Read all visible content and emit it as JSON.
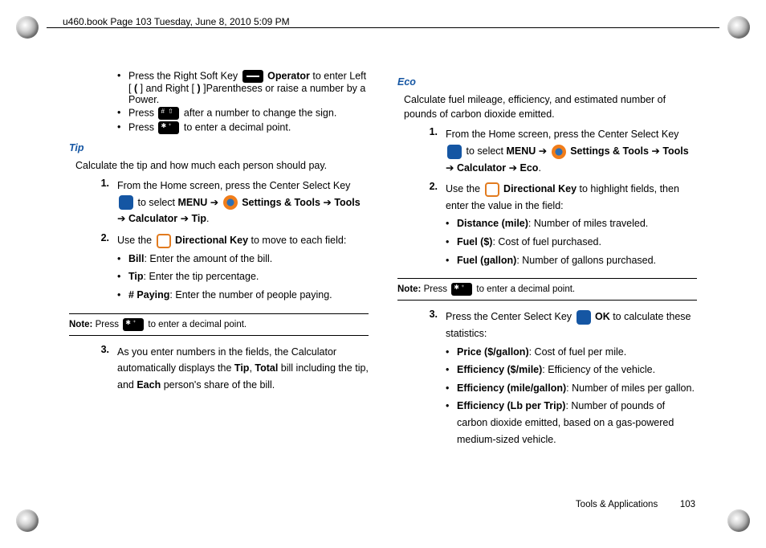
{
  "header": "u460.book  Page 103  Tuesday, June 8, 2010  5:09 PM",
  "left": {
    "b1_a": "Press the Right Soft Key ",
    "b1_b": " Operator",
    "b1_c": " to enter Left [ ",
    "b1_d": "(",
    "b1_e": " ] and Right [ ",
    "b1_f": ")",
    "b1_g": " ]Parentheses or raise a number by a Power.",
    "b2_a": "Press ",
    "b2_b": " after a number to change the sign.",
    "b3_a": "Press ",
    "b3_b": " to enter a decimal point.",
    "h_tip": "Tip",
    "tip_intro": "Calculate the tip and how much each person should pay.",
    "s1_num": "1.",
    "s1_a": "From the Home screen, press the Center Select Key ",
    "s1_b": " to select ",
    "s1_menu": "MENU",
    "arrow": " ➔ ",
    "s1_st": " Settings & Tools",
    "s1_tools": "Tools",
    "s1_calc": "Calculator",
    "s1_tip": "Tip",
    "s2_num": "2.",
    "s2_a": "Use the ",
    "s2_dk": " Directional Key",
    "s2_b": " to move to each field:",
    "sb_bill_l": "Bill",
    "sb_bill": ": Enter the amount of the bill.",
    "sb_tip_l": "Tip",
    "sb_tip": ": Enter the tip percentage.",
    "sb_pay_l": "# Paying",
    "sb_pay": ": Enter the number of people paying.",
    "note_l": "Note:",
    "note_a": " Press ",
    "note_b": " to enter a decimal point.",
    "s3_num": "3.",
    "s3_a": "As you enter numbers in the fields, the Calculator automatically displays the ",
    "s3_tip": "Tip",
    "s3_b": ", ",
    "s3_total": "Total",
    "s3_c": " bill including the tip, and ",
    "s3_each": "Each",
    "s3_d": " person's share of the bill."
  },
  "right": {
    "h_eco": "Eco",
    "eco_intro": "Calculate fuel mileage, efficiency, and estimated number of pounds of carbon dioxide emitted.",
    "s1_num": "1.",
    "s1_a": "From the Home screen, press the Center Select Key ",
    "s1_b": " to select ",
    "s1_menu": "MENU",
    "arrow": " ➔ ",
    "s1_st": " Settings & Tools",
    "s1_tools": "Tools",
    "s1_calc": "Calculator",
    "s1_eco": "Eco",
    "s2_num": "2.",
    "s2_a": "Use the ",
    "s2_dk": " Directional Key",
    "s2_b": " to highlight fields, then enter the value in the field:",
    "sb_dist_l": "Distance (mile)",
    "sb_dist": ": Number of miles traveled.",
    "sb_fs_l": "Fuel ($)",
    "sb_fs": ": Cost of fuel purchased.",
    "sb_fg_l": "Fuel (gallon)",
    "sb_fg": ": Number of gallons purchased.",
    "note_l": "Note:",
    "note_a": " Press ",
    "note_b": " to enter a decimal point.",
    "s3_num": "3.",
    "s3_a": "Press the Center Select Key ",
    "s3_ok": " OK",
    "s3_b": " to calculate these statistics:",
    "sb_pg_l": "Price ($/gallon)",
    "sb_pg": ": Cost of fuel per mile.",
    "sb_esm_l": "Efficiency ($/mile)",
    "sb_esm": ": Efficiency of the vehicle.",
    "sb_emg_l": "Efficiency (mile/gallon)",
    "sb_emg": ": Number of miles per gallon.",
    "sb_elb_l": "Efficiency (Lb per Trip)",
    "sb_elb": ": Number of pounds of carbon dioxide emitted, based on a gas-powered medium-sized vehicle."
  },
  "footer": {
    "section": "Tools & Applications",
    "page": "103"
  }
}
